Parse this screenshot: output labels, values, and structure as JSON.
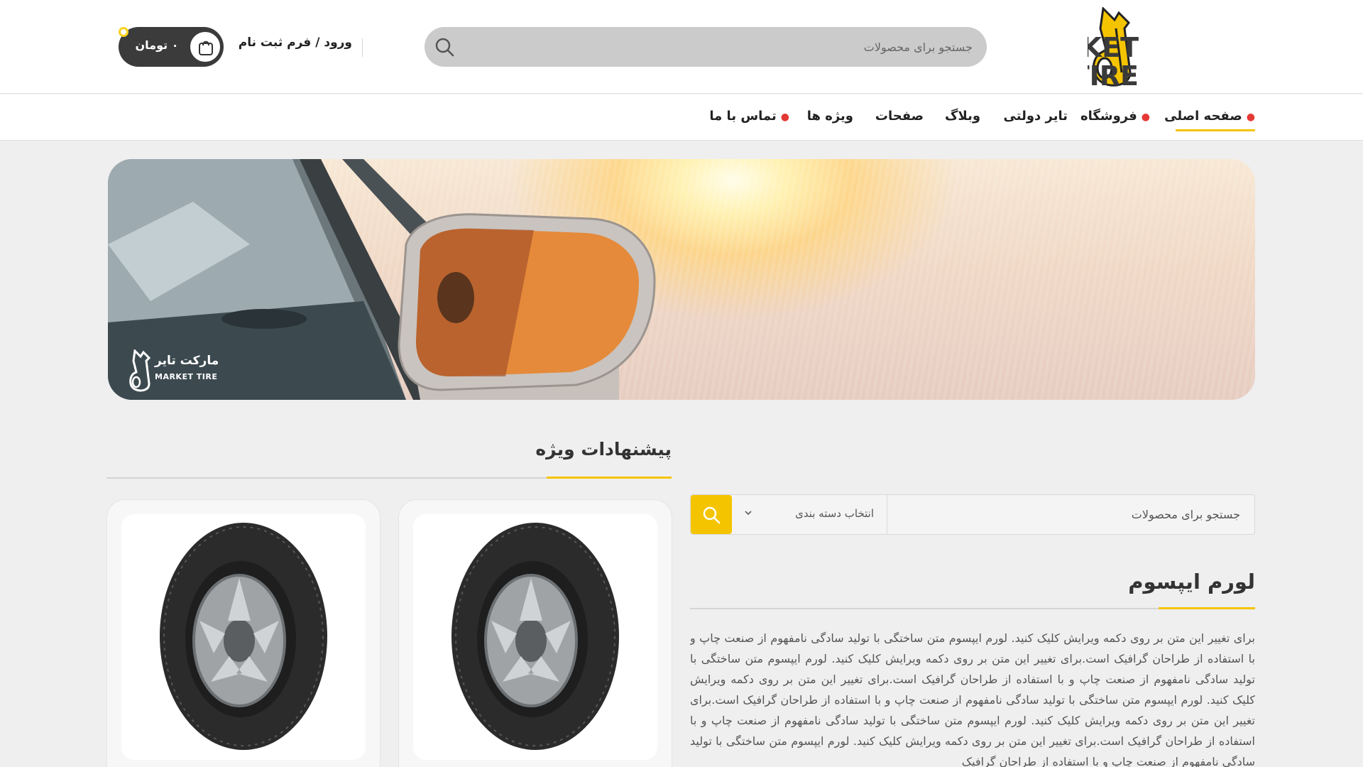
{
  "header": {
    "logo_text_line1": "MARKET",
    "logo_text_line2": "TIRE",
    "search_placeholder": "جستجو برای محصولات",
    "login_label": "ورود / فرم ثبت نام",
    "cart_price": "۰ تومان",
    "cart_count": "۰"
  },
  "nav": {
    "items": [
      {
        "label": "صفحه اصلی",
        "has_bullet": true,
        "active": true
      },
      {
        "label": "فروشگاه",
        "has_bullet": true
      },
      {
        "label": "تایر دولتی"
      },
      {
        "label": "وبلاگ"
      },
      {
        "label": "صفحات"
      },
      {
        "label": "ویژه ها"
      },
      {
        "label": "تماس با ما",
        "has_bullet": true
      }
    ]
  },
  "hero": {
    "brand_fa": "مارکت تایر",
    "brand_en": "MARKET TIRE"
  },
  "special": {
    "title": "پیشنهادات ویژه"
  },
  "sidebar": {
    "search_placeholder": "جستجو برای محصولات",
    "category_label": "انتخاب دسته بندی"
  },
  "article": {
    "title": "لورم ایپسوم",
    "body": "برای تغییر این متن بر روی دکمه ویرایش کلیک کنید. لورم ایپسوم متن ساختگی با تولید سادگی نامفهوم از صنعت چاپ و با استفاده از طراحان گرافیک است.برای تغییر این متن بر روی دکمه ویرایش کلیک کنید. لورم ایپسوم متن ساختگی با تولید سادگی نامفهوم از صنعت چاپ و با استفاده از طراحان گرافیک است.برای تغییر این متن بر روی دکمه ویرایش کلیک کنید. لورم ایپسوم متن ساختگی با تولید سادگی نامفهوم از صنعت چاپ و با استفاده از طراحان گرافیک است.برای تغییر این متن بر روی دکمه ویرایش کلیک کنید. لورم ایپسوم متن ساختگی با تولید سادگی نامفهوم از صنعت چاپ و با استفاده از طراحان گرافیک است.برای تغییر این متن بر روی دکمه ویرایش کلیک کنید. لورم ایپسوم متن ساختگی با تولید سادگی نامفهوم از صنعت چاپ و با استفاده از طراحان گرافیک"
  },
  "colors": {
    "accent": "#f5c400",
    "nav_bullet": "#e53935",
    "cart_bg": "#3b3b3b"
  },
  "icons": {
    "search": "search-icon",
    "cart": "shopping-bag-icon",
    "chevron": "chevron-down-icon",
    "logo": "market-tire-logo"
  }
}
